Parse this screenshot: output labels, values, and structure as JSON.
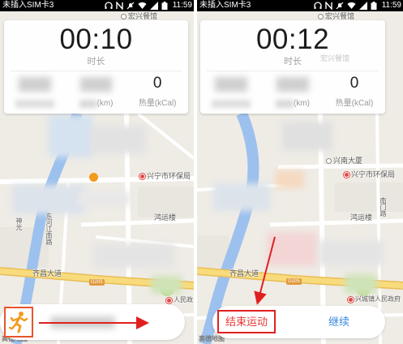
{
  "left": {
    "status": {
      "carrier": "未插入SIM卡3",
      "time": "11:59",
      "icons": [
        "headset-icon",
        "nfc-icon",
        "mute-icon",
        "wifi-icon",
        "signal-icon",
        "battery-icon"
      ]
    },
    "timer": {
      "value": "00:10",
      "label": "时长"
    },
    "stats": {
      "distance_unit": "(km)",
      "calories_value": "0",
      "calories_label": "热量(kCal)"
    },
    "map": {
      "labels": [
        "宏兴餐馆",
        "兴宁市环保局",
        "鸿运楼",
        "齐昌大道",
        "东河江南路",
        "神光",
        "人民政"
      ],
      "road_badge": "G205",
      "logo": "高德地图"
    },
    "controls": {
      "start_icon": "runner-icon"
    }
  },
  "right": {
    "status": {
      "carrier": "未插入SIM卡3",
      "time": "11:59",
      "icons": [
        "headset-icon",
        "nfc-icon",
        "mute-icon",
        "wifi-icon",
        "signal-icon",
        "battery-icon"
      ]
    },
    "timer": {
      "value": "00:12",
      "label": "时长"
    },
    "stats": {
      "distance_unit": "(km)",
      "calories_value": "0",
      "calories_label": "热量(kCal)"
    },
    "map": {
      "labels": [
        "宏兴餐馆",
        "宏兴餐馆",
        "兴南大厦",
        "兴宁市环保局",
        "南门路",
        "鸿运楼",
        "齐昌大道",
        "兴城镇人民政府"
      ],
      "road_badge": "G205",
      "logo": "高德地图"
    },
    "buttons": {
      "end": "结束运动",
      "continue": "继续"
    }
  },
  "colors": {
    "location_dot": "#f39a1e",
    "annotation_red": "#e02020",
    "end_text": "#e53935",
    "continue_text": "#3b8be0",
    "river": "#9dc1ee",
    "main_road": "#f8db7c"
  }
}
